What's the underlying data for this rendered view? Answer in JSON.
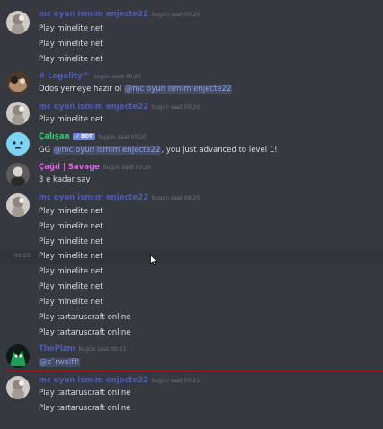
{
  "colors": {
    "background": "#36393f",
    "text": "#dcddde",
    "timestamp": "#72767d",
    "mention_bg": "#3f4672",
    "mention_fg": "#8ea1e1",
    "unread_divider": "#ed4245",
    "bot_tag": "#7289da"
  },
  "messages": [
    {
      "author": "mc oyun ismim enjecte22",
      "author_color": "#4f5bb8",
      "timestamp": "bugün saat 00:20",
      "avatar": "mc-avatar",
      "lines": [
        "Play minelite net",
        "Play minelite net",
        "Play minelite net"
      ]
    },
    {
      "author": "# Legality™",
      "author_color": "#4f5bb8",
      "timestamp": "bugün saat 00:20",
      "avatar": "legality-avatar",
      "text_before": "Ddos yemeye hazir ol ",
      "mention": "@mc oyun ismim enjecte22"
    },
    {
      "author": "mc oyun ismim enjecte22",
      "author_color": "#4f5bb8",
      "timestamp": "bugün saat 00:20",
      "avatar": "mc-avatar",
      "lines": [
        "Play minelite net"
      ]
    },
    {
      "author": "Çalışan",
      "author_color": "#2ecc71",
      "bot_tag": "✓ BOT",
      "timestamp": "bugün saat 00:20",
      "avatar": "bot-avatar",
      "text_before": "GG ",
      "mention": "@mc oyun ismim enjecte22",
      "text_after": ", you just advanced to level 1!"
    },
    {
      "author": "Çağıl | Savage",
      "author_color": "#e362e3",
      "timestamp": "bugün saat 00:20",
      "avatar": "savage-avatar",
      "lines": [
        "3 e kadar say"
      ]
    },
    {
      "author": "mc oyun ismim enjecte22",
      "author_color": "#4f5bb8",
      "timestamp": "bugün saat 00:20",
      "avatar": "mc-avatar",
      "lines": [
        "Play minelite net",
        "Play minelite net",
        "Play minelite net"
      ],
      "hover_timestamp": "00:20",
      "hover_line": "Play minelite net",
      "more_lines": [
        "Play minelite net",
        "Play minelite net",
        "Play minelite net",
        "Play tartaruscraft online",
        "Play tartaruscraft online"
      ]
    },
    {
      "author": "ThePizm",
      "author_color": "#4f5bb8",
      "timestamp": "bugün saat 00:21",
      "avatar": "pizm-avatar",
      "mention": "@z`rwolff!"
    },
    {
      "author": "mc oyun ismim enjecte22",
      "author_color": "#4f5bb8",
      "timestamp": "bugün saat 00:21",
      "avatar": "mc-avatar",
      "lines": [
        "Play tartaruscraft online",
        "Play tartaruscraft online"
      ]
    }
  ]
}
